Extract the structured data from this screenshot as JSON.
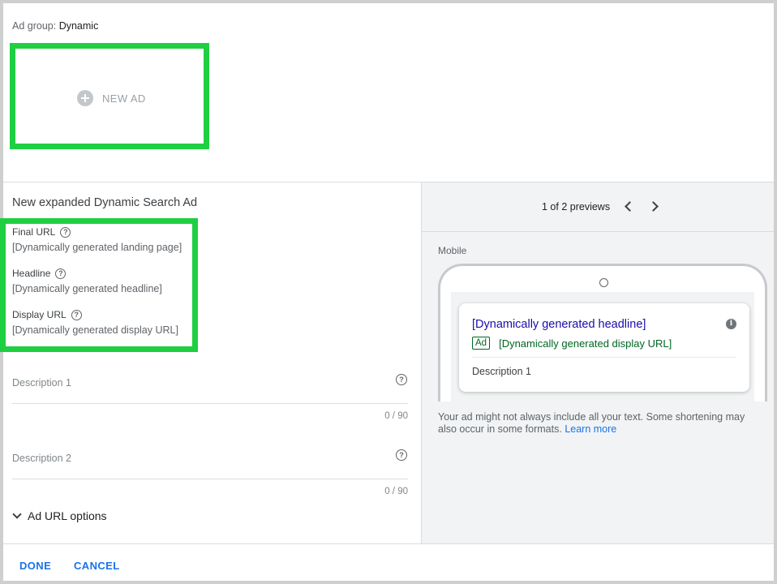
{
  "ad_group": {
    "label": "Ad group:",
    "name": "Dynamic"
  },
  "new_ad": {
    "label": "NEW AD"
  },
  "form": {
    "title": "New expanded Dynamic Search Ad",
    "final_url": {
      "label": "Final URL",
      "value": "[Dynamically generated landing page]"
    },
    "headline": {
      "label": "Headline",
      "value": "[Dynamically generated headline]"
    },
    "display_url": {
      "label": "Display URL",
      "value": "[Dynamically generated display URL]"
    },
    "description1": {
      "placeholder": "Description 1",
      "counter": "0 / 90"
    },
    "description2": {
      "placeholder": "Description 2",
      "counter": "0 / 90"
    },
    "url_options": "Ad URL options"
  },
  "preview": {
    "count": "1 of 2 previews",
    "device": "Mobile",
    "ad": {
      "headline": "[Dynamically generated headline]",
      "badge": "Ad",
      "display_url": "[Dynamically generated display URL]",
      "description": "Description 1"
    },
    "disclaimer": "Your ad might not always include all your text. Some shortening may also occur in some formats.",
    "learn_more": "Learn more"
  },
  "footer": {
    "done": "DONE",
    "cancel": "CANCEL"
  },
  "colors": {
    "highlight": "#1fcf42",
    "link": "#1a73e8",
    "ad_headline": "#1a0dab",
    "ad_url": "#006621"
  }
}
